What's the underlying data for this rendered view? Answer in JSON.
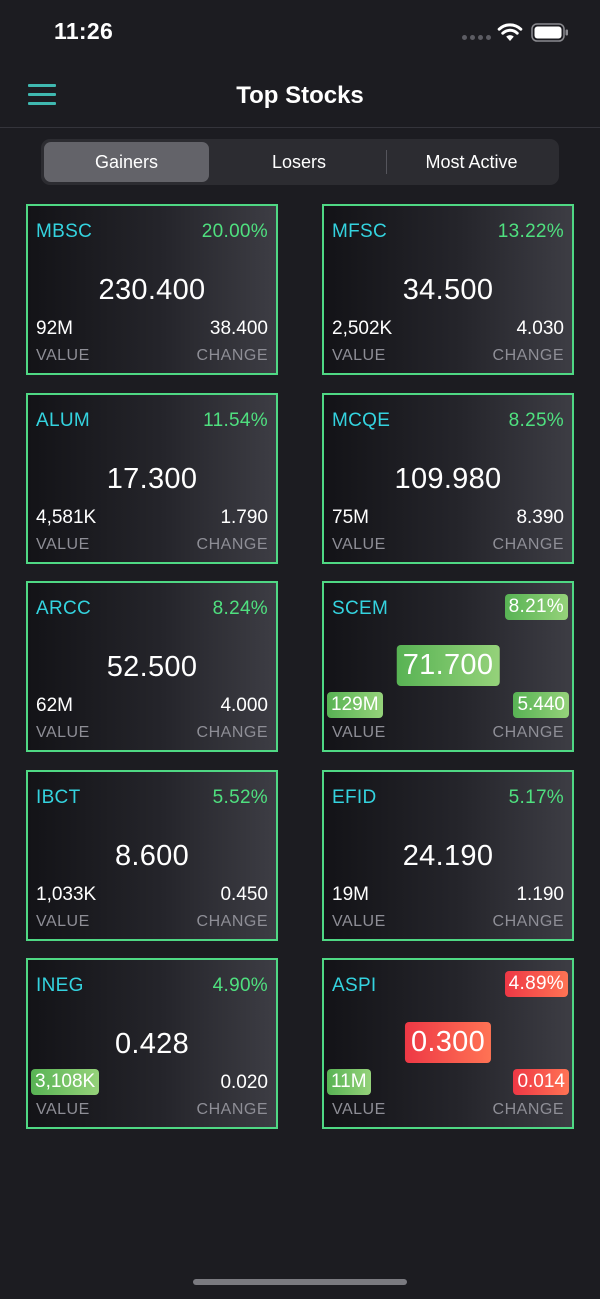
{
  "status": {
    "time": "11:26"
  },
  "header": {
    "title": "Top Stocks"
  },
  "tabs": [
    {
      "label": "Gainers",
      "active": true
    },
    {
      "label": "Losers",
      "active": false
    },
    {
      "label": "Most Active",
      "active": false
    }
  ],
  "colors": {
    "accent": "#3fb8b0",
    "border": "#4fd884",
    "symbol": "#34d3df",
    "gain": "#4fe07f",
    "loss": "#ff4b4b"
  },
  "labels": {
    "value": "VALUE",
    "change": "CHANGE"
  },
  "stocks": [
    {
      "symbol": "MBSC",
      "percent": "20.00%",
      "price": "230.400",
      "value": "92M",
      "change": "38.400"
    },
    {
      "symbol": "MFSC",
      "percent": "13.22%",
      "price": "34.500",
      "value": "2,502K",
      "change": "4.030"
    },
    {
      "symbol": "ALUM",
      "percent": "11.54%",
      "price": "17.300",
      "value": "4,581K",
      "change": "1.790"
    },
    {
      "symbol": "MCQE",
      "percent": "8.25%",
      "price": "109.980",
      "value": "75M",
      "change": "8.390"
    },
    {
      "symbol": "ARCC",
      "percent": "8.24%",
      "price": "52.500",
      "value": "62M",
      "change": "4.000"
    },
    {
      "symbol": "SCEM",
      "percent": "8.21%",
      "price": "71.700",
      "value": "129M",
      "change": "5.440"
    },
    {
      "symbol": "IBCT",
      "percent": "5.52%",
      "price": "8.600",
      "value": "1,033K",
      "change": "0.450"
    },
    {
      "symbol": "EFID",
      "percent": "5.17%",
      "price": "24.190",
      "value": "19M",
      "change": "1.190"
    },
    {
      "symbol": "INEG",
      "percent": "4.90%",
      "price": "0.428",
      "value": "3,108K",
      "change": "0.020"
    },
    {
      "symbol": "ASPI",
      "percent": "4.89%",
      "price": "0.300",
      "value": "11M",
      "change": "0.014"
    }
  ]
}
